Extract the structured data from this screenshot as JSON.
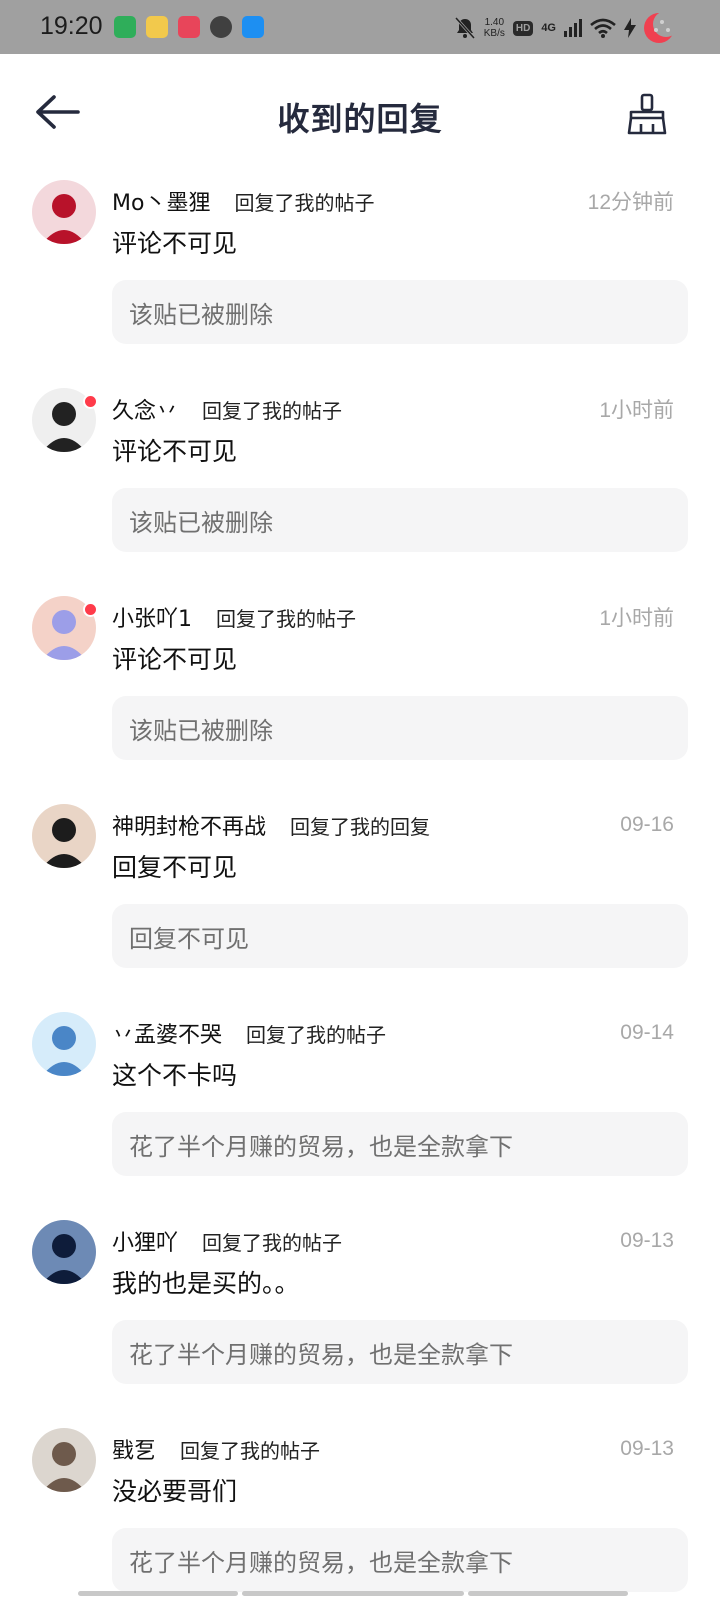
{
  "status_bar": {
    "time": "19:20",
    "net_speed_value": "1.40",
    "net_speed_unit": "KB/s",
    "hd_badge": "HD",
    "network": "4G",
    "app_icon_colors": [
      "#2fae5a",
      "#f2c94c",
      "#e8455a",
      "#404040",
      "#1d8ff2"
    ]
  },
  "header": {
    "title": "收到的回复"
  },
  "replies": [
    {
      "user": "Mo丶墨狸",
      "action": "回复了我的帖子",
      "time": "12分钟前",
      "content": "评论不可见",
      "quote": "该贴已被删除",
      "unread": false,
      "avatar": [
        "#b8122a",
        "#f3d8dc"
      ]
    },
    {
      "user": "久念丷",
      "action": "回复了我的帖子",
      "time": "1小时前",
      "content": "评论不可见",
      "quote": "该贴已被删除",
      "unread": true,
      "avatar": [
        "#222222",
        "#efefef"
      ]
    },
    {
      "user": "小张吖1",
      "action": "回复了我的帖子",
      "time": "1小时前",
      "content": "评论不可见",
      "quote": "该贴已被删除",
      "unread": true,
      "avatar": [
        "#9c9ee8",
        "#f4d2c8"
      ]
    },
    {
      "user": "神明封枪不再战",
      "action": "回复了我的回复",
      "time": "09-16",
      "content": "回复不可见",
      "quote": "回复不可见",
      "unread": false,
      "avatar": [
        "#1c1c1c",
        "#e9d5c6"
      ]
    },
    {
      "user": "丷孟婆不哭",
      "action": "回复了我的帖子",
      "time": "09-14",
      "content": "这个不卡吗",
      "quote": "花了半个月赚的贸易，也是全款拿下",
      "unread": false,
      "avatar": [
        "#4a86c7",
        "#d6ecfa"
      ]
    },
    {
      "user": "小狸吖",
      "action": "回复了我的帖子",
      "time": "09-13",
      "content": "我的也是买的。。",
      "quote": "花了半个月赚的贸易，也是全款拿下",
      "unread": false,
      "avatar": [
        "#0e1c3a",
        "#6d8ab5"
      ]
    },
    {
      "user": "戥乭",
      "action": "回复了我的帖子",
      "time": "09-13",
      "content": "没必要哥们",
      "quote": "花了半个月赚的贸易，也是全款拿下",
      "unread": false,
      "avatar": [
        "#6e5a4c",
        "#dcd6cf"
      ]
    }
  ]
}
